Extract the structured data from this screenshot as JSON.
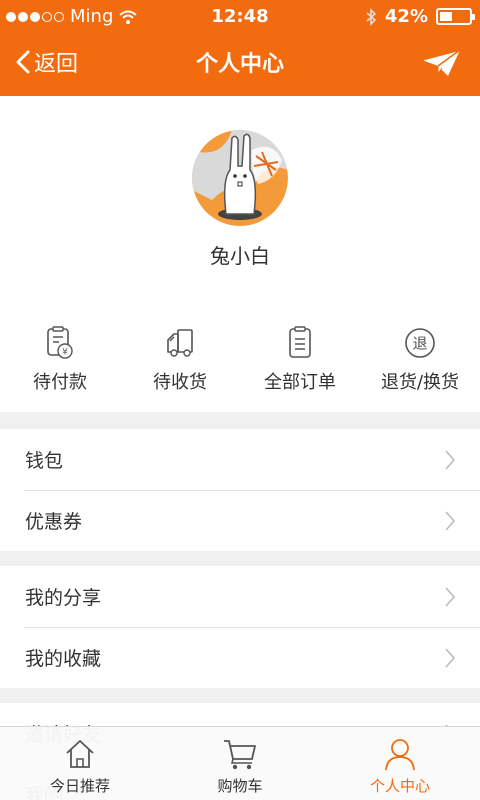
{
  "status_bar": {
    "carrier": "Ming",
    "time": "12:48",
    "battery": "42%",
    "battery_level": 0.42
  },
  "nav": {
    "back_label": "返回",
    "title": "个人中心",
    "right_icon": "paper-plane-icon"
  },
  "profile": {
    "username": "兔小白"
  },
  "orders": [
    {
      "label": "待付款",
      "icon": "pending-payment-icon"
    },
    {
      "label": "待收货",
      "icon": "truck-icon"
    },
    {
      "label": "全部订单",
      "icon": "clipboard-list-icon"
    },
    {
      "label": "退货/换货",
      "icon": "return-icon",
      "icon_text": "退"
    }
  ],
  "menu_groups": [
    [
      {
        "label": "钱包"
      },
      {
        "label": "优惠券"
      }
    ],
    [
      {
        "label": "我的分享"
      },
      {
        "label": "我的收藏"
      }
    ],
    [
      {
        "label": "邀请好友"
      },
      {
        "label": "我的"
      }
    ]
  ],
  "tabs": [
    {
      "label": "今日推荐",
      "icon": "home-icon",
      "active": false
    },
    {
      "label": "购物车",
      "icon": "cart-icon",
      "active": false
    },
    {
      "label": "个人中心",
      "icon": "user-icon",
      "active": true
    }
  ],
  "colors": {
    "brand": "#f26b0f",
    "background": "#f0f0f0",
    "text": "#333333",
    "icon": "#555555"
  }
}
